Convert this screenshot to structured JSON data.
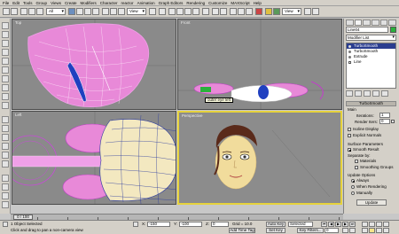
{
  "menu": [
    "File",
    "Edit",
    "Tools",
    "Group",
    "Views",
    "Create",
    "Modifiers",
    "Character",
    "reactor",
    "Animation",
    "Graph Editors",
    "Rendering",
    "Customize",
    "MAXScript",
    "Help"
  ],
  "toolbar": {
    "selection_filter": "All",
    "ref_coord": "View"
  },
  "viewports": {
    "top": {
      "label": "Top"
    },
    "front": {
      "label": "Front",
      "tooltip": "outer eye left"
    },
    "left": {
      "label": "Left"
    },
    "perspective": {
      "label": "Perspective"
    }
  },
  "command_panel": {
    "object_name": "Line04",
    "object_color": "#2ab13c",
    "modifier_list": "Modifier List",
    "stack": [
      "TurboSmooth",
      "TurboSmooth",
      "Extrude",
      "Line"
    ],
    "rollout_title": "TurboSmooth",
    "main_label": "Main",
    "iterations_label": "Iterations:",
    "iterations_value": "1",
    "render_iters_label": "Render Iters:",
    "render_iters_value": "0",
    "isoline_label": "Isoline Display",
    "explicit_normals_label": "Explicit Normals",
    "surface_params_label": "Surface Parameters",
    "smooth_result_label": "Smooth Result",
    "separate_by_label": "Separate by:",
    "materials_label": "Materials",
    "smoothing_groups_label": "Smoothing Groups",
    "update_options_label": "Update Options",
    "always_label": "Always",
    "when_rendering_label": "When Rendering",
    "manually_label": "Manually",
    "update_button": "Update"
  },
  "timeline": {
    "slider_label": "0 / 100",
    "ticks": [
      "0",
      "10",
      "20",
      "30",
      "40",
      "50",
      "60",
      "70",
      "80",
      "90",
      "100"
    ]
  },
  "status": {
    "selected": "1 Object Selected",
    "prompt": "Click and drag to pan a non-camera view",
    "x_label": "X:",
    "x_value": "-150",
    "y_label": "Y:",
    "y_value": "-100",
    "z_label": "Z:",
    "z_value": "0",
    "grid": "Grid = 10.0",
    "add_time_tag": "Add Time Tag",
    "auto_key": "Auto Key",
    "selected_dd": "Selected",
    "set_key": "Set Key",
    "key_filters": "Key Filters...",
    "frame": "0"
  }
}
